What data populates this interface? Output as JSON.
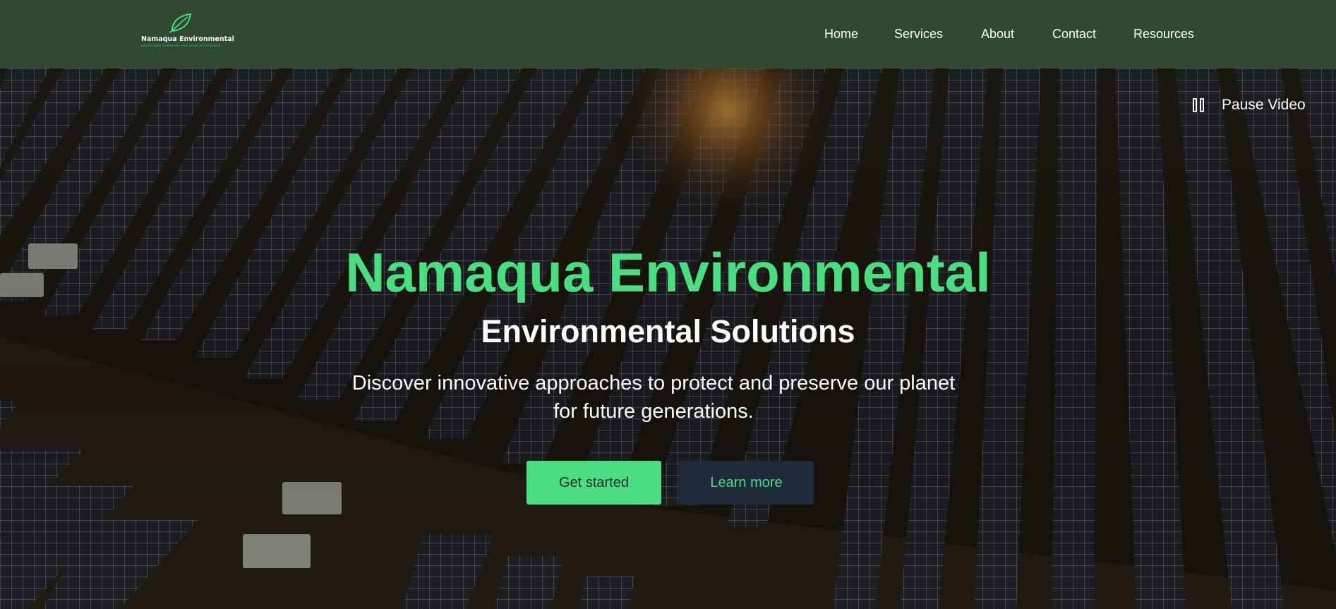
{
  "header": {
    "logo": {
      "name": "Namaqua Environmental",
      "tagline": "SOLUTIONS THROUGH THE LENS OF SCIENCE",
      "icon": "leaf-icon"
    },
    "nav": [
      {
        "label": "Home"
      },
      {
        "label": "Services"
      },
      {
        "label": "About"
      },
      {
        "label": "Contact"
      },
      {
        "label": "Resources"
      }
    ]
  },
  "hero": {
    "pause": {
      "label": "Pause Video",
      "icon": "pause-icon"
    },
    "title": "Namaqua Environmental",
    "subtitle": "Environmental Solutions",
    "description": "Discover innovative approaches to protect and preserve our planet for future generations.",
    "primary_button": "Get started",
    "secondary_button": "Learn more"
  },
  "colors": {
    "header_bg": "#2f4a30",
    "accent": "#4ade80",
    "secondary_button_bg": "#1f2a3a"
  }
}
